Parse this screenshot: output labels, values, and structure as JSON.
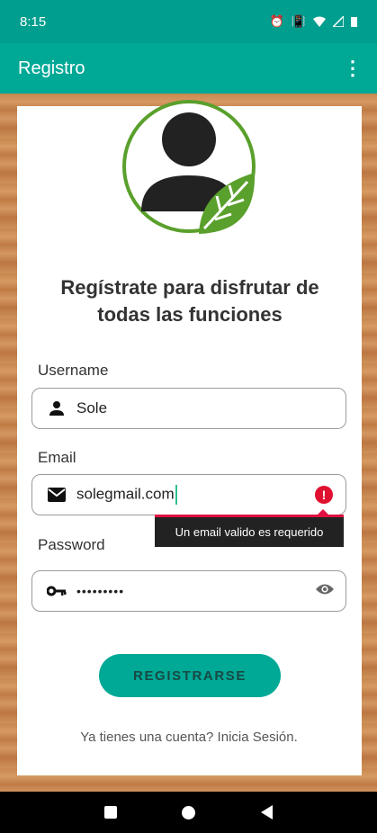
{
  "status_bar": {
    "time": "8:15"
  },
  "app_bar": {
    "title": "Registro",
    "menu_icon": "more-vert-icon"
  },
  "headline": "Regístrate para disfrutar de todas las funciones",
  "form": {
    "username": {
      "label": "Username",
      "value": "Sole"
    },
    "email": {
      "label": "Email",
      "value": "solegmail.com",
      "error": "Un email valido es requerido"
    },
    "password": {
      "label": "Password",
      "value": "•••••••••"
    }
  },
  "register_button": "REGISTRARSE",
  "login_link": "Ya tienes una cuenta? Inicia Sesión.",
  "colors": {
    "primary": "#00a896",
    "error": "#e01030"
  }
}
